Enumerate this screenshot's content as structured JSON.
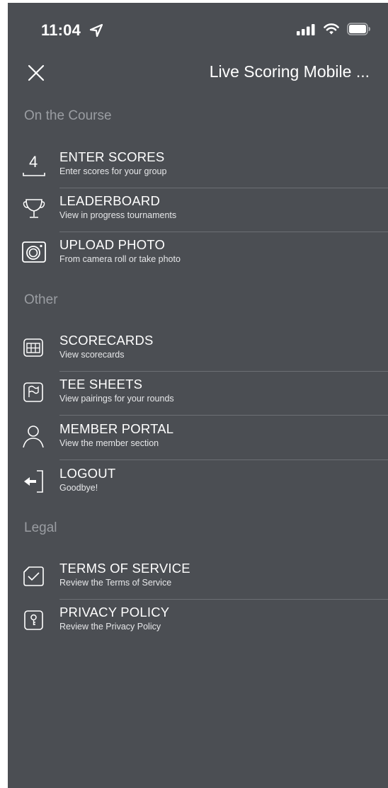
{
  "status_bar": {
    "time": "11:04"
  },
  "header": {
    "title": "Live Scoring Mobile ..."
  },
  "sections": [
    {
      "header": "On the Course",
      "items": [
        {
          "icon": "enter-scores-icon",
          "title": "ENTER SCORES",
          "subtitle": "Enter scores for your group",
          "icon_text": "4"
        },
        {
          "icon": "trophy-icon",
          "title": "LEADERBOARD",
          "subtitle": "View in progress tournaments"
        },
        {
          "icon": "camera-icon",
          "title": "UPLOAD PHOTO",
          "subtitle": "From camera roll or take photo"
        }
      ]
    },
    {
      "header": "Other",
      "items": [
        {
          "icon": "scorecard-grid-icon",
          "title": "SCORECARDS",
          "subtitle": "View scorecards"
        },
        {
          "icon": "flag-icon",
          "title": "TEE SHEETS",
          "subtitle": "View pairings for your rounds"
        },
        {
          "icon": "user-icon",
          "title": "MEMBER PORTAL",
          "subtitle": "View the member section"
        },
        {
          "icon": "logout-icon",
          "title": "LOGOUT",
          "subtitle": "Goodbye!"
        }
      ]
    },
    {
      "header": "Legal",
      "items": [
        {
          "icon": "terms-check-icon",
          "title": "TERMS OF SERVICE",
          "subtitle": "Review the Terms of Service"
        },
        {
          "icon": "privacy-lock-icon",
          "title": "PRIVACY POLICY",
          "subtitle": "Review the Privacy Policy"
        }
      ]
    }
  ],
  "colors": {
    "background": "#4b4e53",
    "section_header": "#9a9da2",
    "divider": "#6c6f74",
    "text": "#ffffff"
  }
}
